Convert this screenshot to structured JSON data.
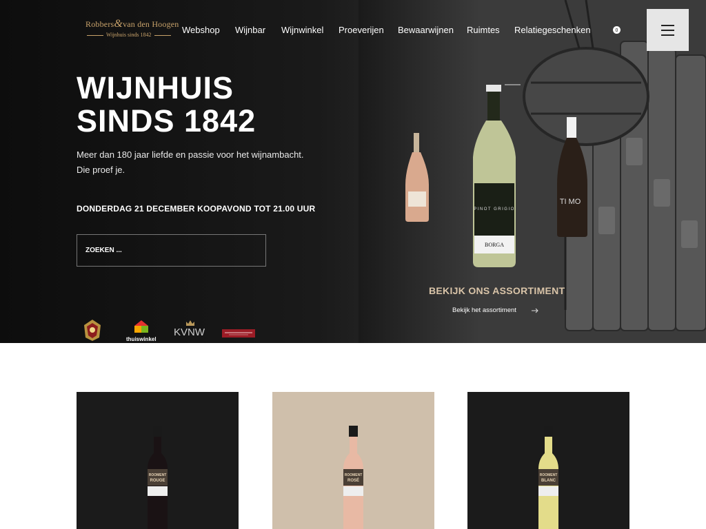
{
  "brand": {
    "name_part1": "Robbers",
    "name_amp": "&",
    "name_part2": "van den Hoogen",
    "tagline": "Wijnhuis sinds 1842",
    "accent_color": "#c9a36b"
  },
  "nav": {
    "items": [
      {
        "label": "Webshop"
      },
      {
        "label": "Wijnbar"
      },
      {
        "label": "Wijnwinkel"
      },
      {
        "label": "Proeverijen"
      },
      {
        "label": "Bewaarwijnen"
      },
      {
        "label": "Ruimtes"
      },
      {
        "label": "Relatiegeschenken"
      }
    ],
    "cart_count": "0",
    "menu_icon": "hamburger-icon"
  },
  "hero": {
    "title": "WIJNHUIS\nSINDS 1842",
    "subtitle": "Meer dan 180 jaar liefde en passie voor het wijnambacht.\nDie proef je.",
    "announcement": "DONDERDAG 21 DECEMBER KOOPAVOND TOT 21.00 UUR",
    "search_placeholder": "ZOEKEN ...",
    "bottles": [
      {
        "label": "PINOT GRIGIO",
        "brand": "BORGA"
      },
      {
        "label": "TI MO"
      }
    ]
  },
  "assortment": {
    "title": "BEKIJK ONS ASSORTIMENT",
    "link_label": "Bekijk het assortiment",
    "link_icon": "arrow-right-icon",
    "title_color": "#d9c4a8"
  },
  "badges": [
    {
      "name": "royal-crest"
    },
    {
      "name": "thuiswinkel",
      "label": "thuiswinkel"
    },
    {
      "name": "kvnw",
      "label": "KVNW"
    },
    {
      "name": "wine-association"
    }
  ],
  "products": [
    {
      "bg_color": "#1b1b1b",
      "wine_color": "#1a1214",
      "label_line1": "ROOMENT",
      "label_line2": "ROUGE"
    },
    {
      "bg_color": "#cfbfab",
      "wine_color": "#e8b9a4",
      "label_line1": "ROOMENT",
      "label_line2": "ROSÉ"
    },
    {
      "bg_color": "#1b1b1b",
      "wine_color": "#e3dc8a",
      "label_line1": "ROOMENT",
      "label_line2": "BLANC"
    }
  ]
}
